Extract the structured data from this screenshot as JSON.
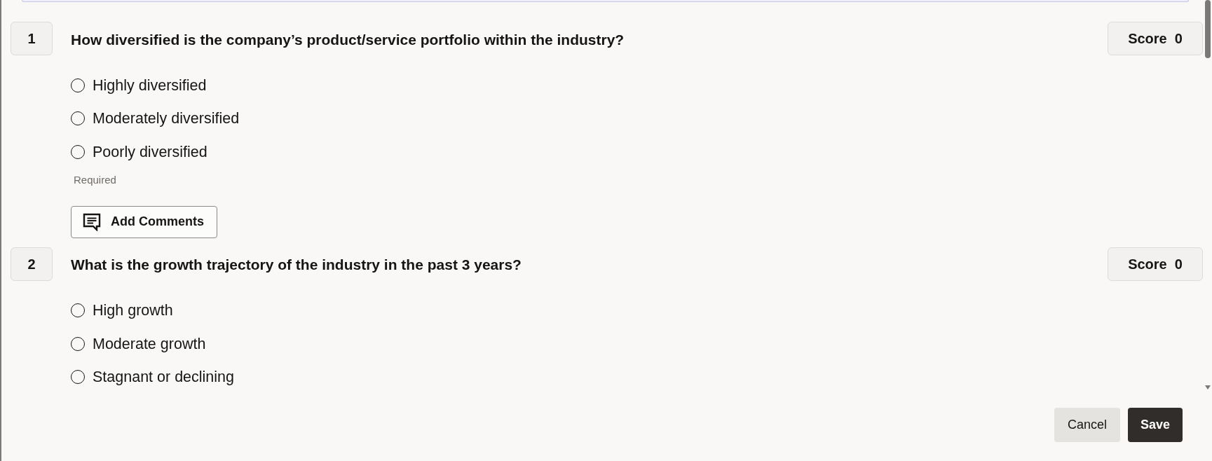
{
  "questions": [
    {
      "number": "1",
      "text": "How diversified is the company’s product/service portfolio within the industry?",
      "score_label": "Score",
      "score": "0",
      "options": [
        {
          "label": "Highly diversified",
          "selected": false
        },
        {
          "label": "Moderately diversified",
          "selected": false
        },
        {
          "label": "Poorly diversified",
          "selected": false
        }
      ],
      "hint": "Required",
      "comment_button": "Add Comments"
    },
    {
      "number": "2",
      "text": "What is the growth trajectory of the industry in the past 3 years?",
      "score_label": "Score",
      "score": "0",
      "options": [
        {
          "label": "High growth",
          "selected": false
        },
        {
          "label": "Moderate growth",
          "selected": false
        },
        {
          "label": "Stagnant or declining",
          "selected": false
        }
      ]
    }
  ],
  "actions": [
    {
      "label": "Cancel",
      "kind": "secondary"
    },
    {
      "label": "Save",
      "kind": "primary"
    }
  ]
}
